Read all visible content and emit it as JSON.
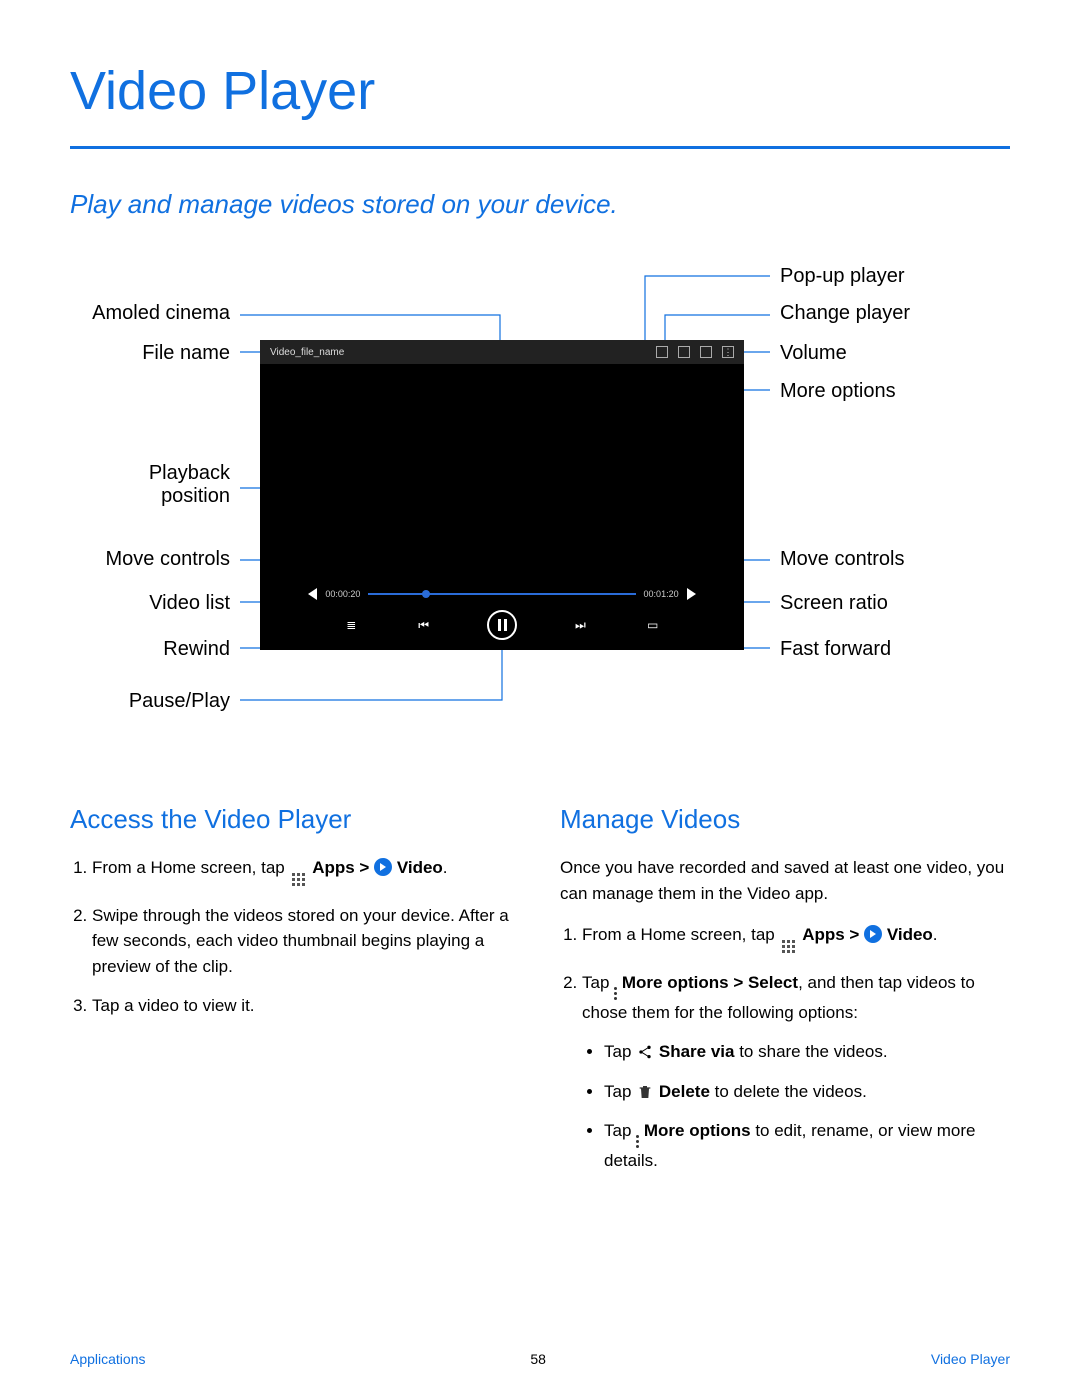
{
  "page": {
    "title": "Video Player",
    "subtitle": "Play and manage videos stored on your device."
  },
  "player": {
    "file_name_label": "Video_file_name",
    "time_current": "00:00:20",
    "time_total": "00:01:20"
  },
  "callouts": {
    "amoled_cinema": "Amoled cinema",
    "file_name": "File name",
    "playback_position": "Playback\nposition",
    "move_controls_left": "Move controls",
    "video_list": "Video list",
    "rewind": "Rewind",
    "pause_play": "Pause/Play",
    "popup_player": "Pop-up player",
    "change_player": "Change player",
    "volume": "Volume",
    "more_options": "More options",
    "move_controls_right": "Move controls",
    "screen_ratio": "Screen ratio",
    "fast_forward": "Fast forward"
  },
  "sections": {
    "access": {
      "heading": "Access the Video Player",
      "step1_a": "From a Home screen, tap ",
      "step1_b": " Apps > ",
      "step1_c": " Video",
      "step1_d": ".",
      "step2": "Swipe through the videos stored on your device. After a few seconds, each video thumbnail begins playing a preview of the clip.",
      "step3": "Tap a video to view it."
    },
    "manage": {
      "heading": "Manage Videos",
      "intro": "Once you have recorded and saved at least one video, you can manage them in the Video app.",
      "step1_a": "From a Home screen, tap ",
      "step1_b": " Apps > ",
      "step1_c": " Video",
      "step1_d": ".",
      "step2_a": "Tap ",
      "step2_b": " More options > Select",
      "step2_c": ", and then tap videos to chose them for the following options:",
      "bullet1_a": "Tap ",
      "bullet1_b": " Share via",
      "bullet1_c": " to share the videos.",
      "bullet2_a": "Tap ",
      "bullet2_b": " Delete",
      "bullet2_c": " to delete the videos.",
      "bullet3_a": "Tap ",
      "bullet3_b": " More options",
      "bullet3_c": " to edit, rename, or view more details."
    }
  },
  "footer": {
    "left": "Applications",
    "center": "58",
    "right": "Video Player"
  }
}
